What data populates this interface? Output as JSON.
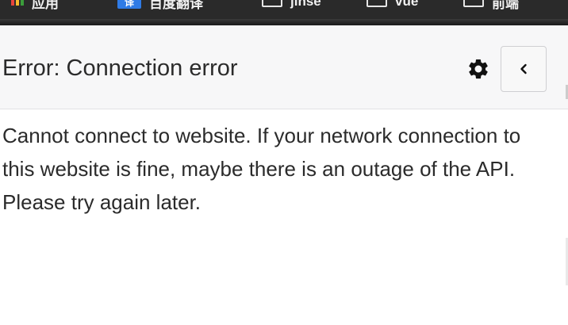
{
  "bookmarks_bar": {
    "items": [
      {
        "label": "应用"
      },
      {
        "label": "百度翻译",
        "icon_text": "译"
      },
      {
        "label": "jinse"
      },
      {
        "label": "vue"
      },
      {
        "label": "前端"
      }
    ]
  },
  "panel": {
    "title": "Error: Connection error",
    "settings_icon": "gear-icon",
    "back_icon": "chevron-left-icon",
    "message": "Cannot connect to website. If your network connection to this website is fine, maybe there is an outage of the API. Please try again later."
  },
  "colors": {
    "header_bg": "#f7f7f8",
    "text": "#2b2b2b",
    "border": "#cfcfd2",
    "bookmarks_bg": "#2a2a2a"
  }
}
